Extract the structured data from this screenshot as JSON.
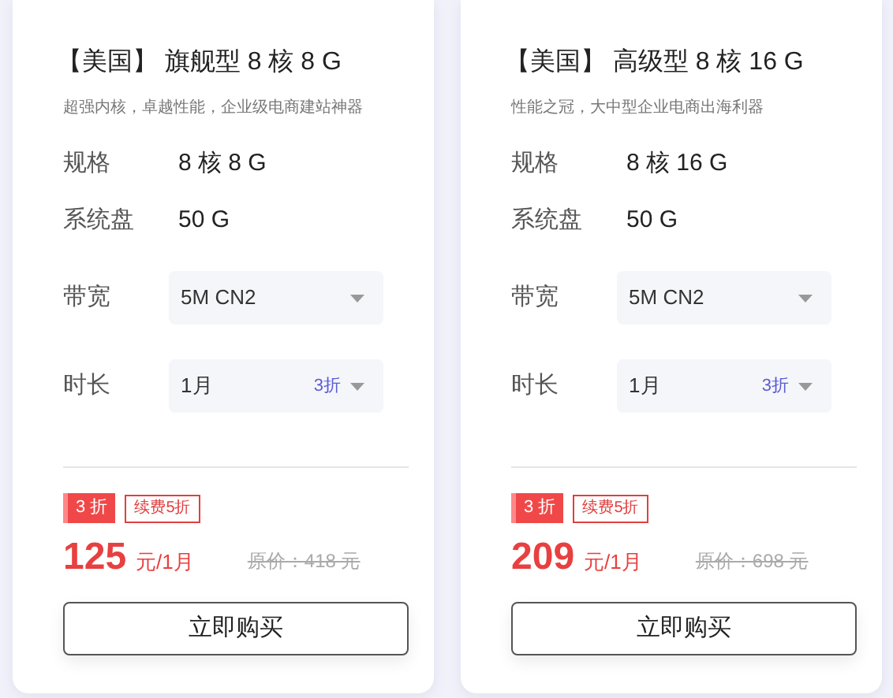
{
  "cards": [
    {
      "title": "【美国】 旗舰型 8 核 8 G",
      "subtitle": "超强内核，卓越性能，企业级电商建站神器",
      "specs": [
        {
          "kind": "text",
          "label": "规格",
          "value": "8 核 8 G"
        },
        {
          "kind": "text",
          "label": "系统盘",
          "value": "50 G"
        },
        {
          "kind": "select",
          "label": "带宽",
          "value": "5M CN2"
        },
        {
          "kind": "select",
          "label": "时长",
          "value": "1月",
          "tag": "3折"
        }
      ],
      "discount": "3 折",
      "renewal": "续费5折",
      "price": "125",
      "unit": "元/1月",
      "original_price": "原价：418 元",
      "button": "立即购买"
    },
    {
      "title": "【美国】 高级型 8 核 16 G",
      "subtitle": "性能之冠，大中型企业电商出海利器",
      "specs": [
        {
          "kind": "text",
          "label": "规格",
          "value": "8 核 16 G"
        },
        {
          "kind": "text",
          "label": "系统盘",
          "value": "50 G"
        },
        {
          "kind": "select",
          "label": "带宽",
          "value": "5M CN2"
        },
        {
          "kind": "select",
          "label": "时长",
          "value": "1月",
          "tag": "3折"
        }
      ],
      "discount": "3 折",
      "renewal": "续费5折",
      "price": "209",
      "unit": "元/1月",
      "original_price": "原价：698 元",
      "button": "立即购买"
    }
  ]
}
